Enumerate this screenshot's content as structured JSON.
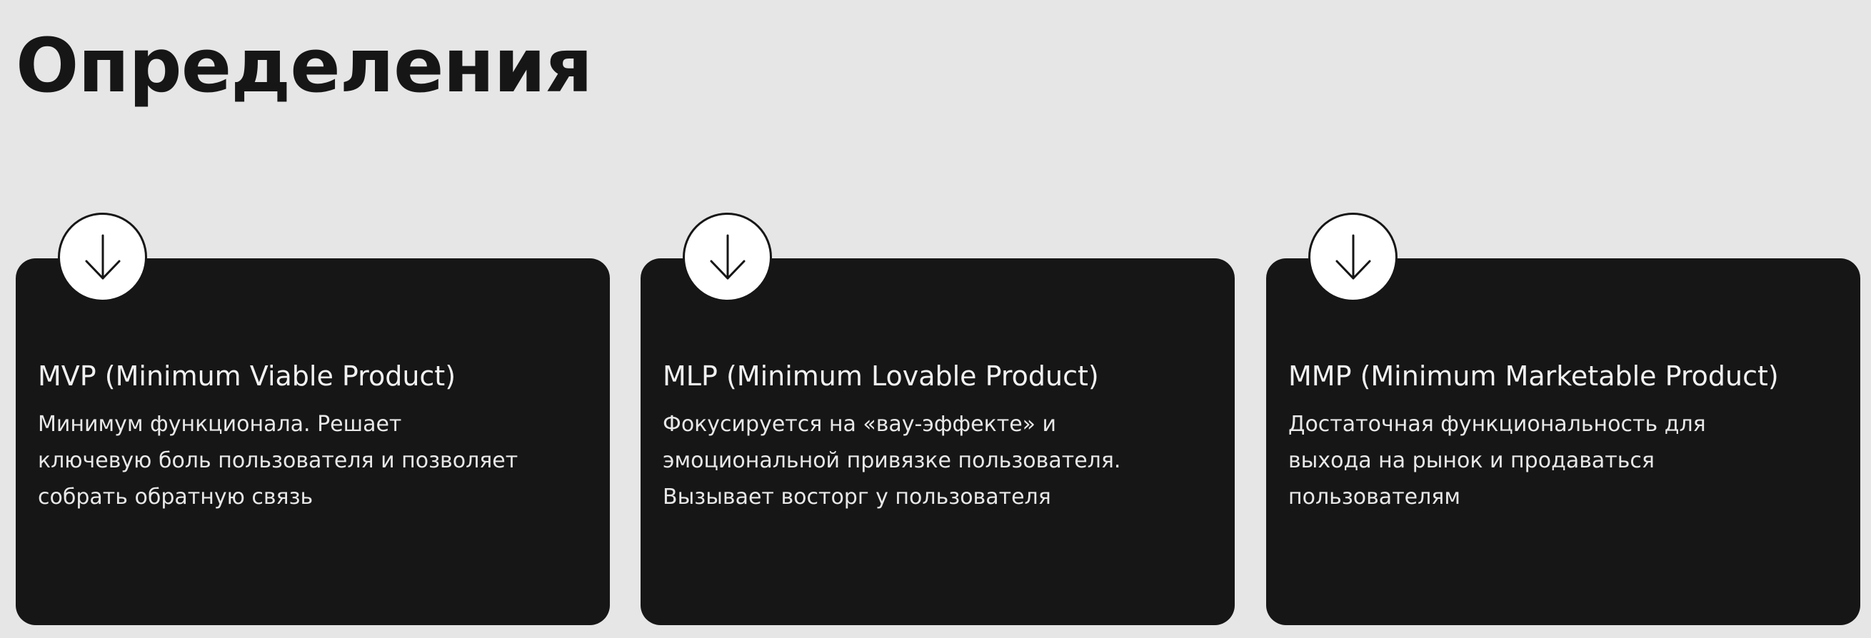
{
  "page": {
    "title": "Определения"
  },
  "colors": {
    "background": "#e6e6e6",
    "card": "#161616",
    "badge": "#ffffff",
    "text_light": "#f2f2f2"
  },
  "cards": [
    {
      "icon": "arrow-down-icon",
      "title": "MVP (Minimum Viable Product)",
      "lines": [
        "Минимум функционала. Решает",
        "ключевую боль пользователя и позволяет",
        "собрать обратную связь"
      ]
    },
    {
      "icon": "arrow-down-icon",
      "title": "MLP (Minimum Lovable Product)",
      "lines": [
        "Фокусируется на «вау-эффекте» и",
        "эмоциональной привязке пользователя.",
        "Вызывает восторг у пользователя"
      ]
    },
    {
      "icon": "arrow-down-icon",
      "title": "MMP (Minimum Marketable Product)",
      "lines": [
        "Достаточная функциональность для",
        "выхода на рынок и продаваться",
        "пользователям"
      ]
    }
  ]
}
